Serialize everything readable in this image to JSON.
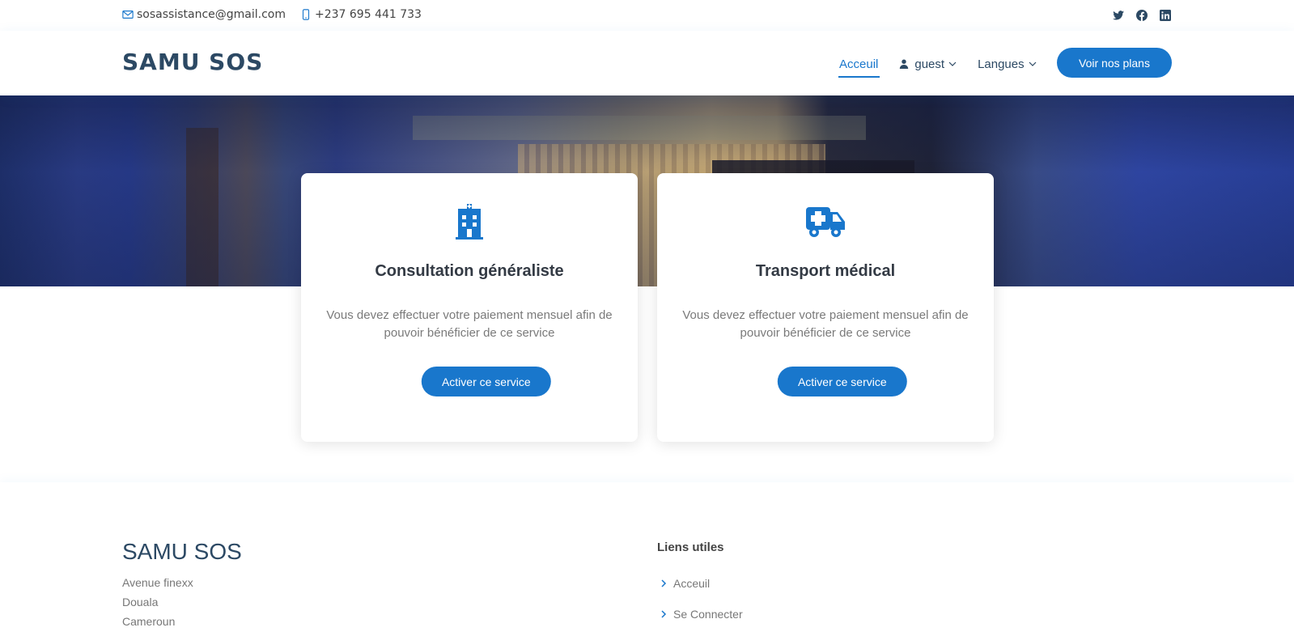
{
  "topbar": {
    "email": "sosassistance@gmail.com",
    "phone": "+237 695 441 733",
    "social": [
      "twitter-icon",
      "facebook-icon",
      "linkedin-icon"
    ]
  },
  "header": {
    "logo": "SAMU SOS",
    "nav": {
      "home": "Acceuil",
      "user": "guest",
      "languages": "Langues"
    },
    "cta": "Voir nos plans"
  },
  "colors": {
    "accent": "#1977cc",
    "heading": "#2c4964"
  },
  "cards": [
    {
      "icon": "hospital-icon",
      "title": "Consultation généraliste",
      "description": "Vous devez effectuer votre paiement mensuel afin de pouvoir bénéficier de ce service",
      "button": "Activer ce service"
    },
    {
      "icon": "ambulance-icon",
      "title": "Transport médical",
      "description": "Vous devez effectuer votre paiement mensuel afin de pouvoir bénéficier de ce service",
      "button": "Activer ce service"
    }
  ],
  "footer": {
    "brand": "SAMU SOS",
    "address": [
      "Avenue finexx",
      "Douala",
      "Cameroun"
    ],
    "links_title": "Liens utiles",
    "links": [
      "Acceuil",
      "Se Connecter"
    ]
  }
}
